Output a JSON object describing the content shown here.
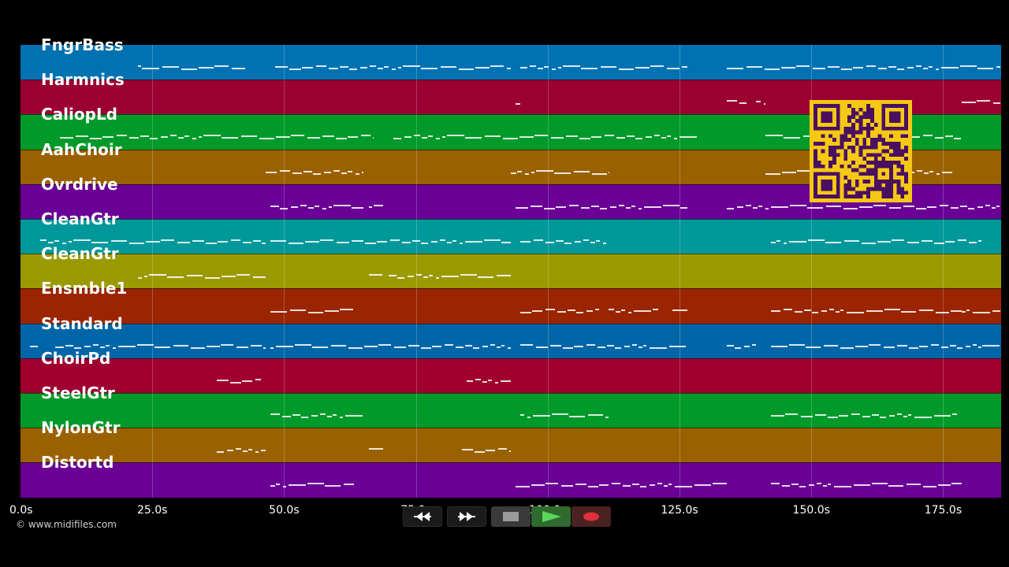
{
  "tracks": [
    {
      "name": "FngrBass",
      "color": "#0072b2",
      "notes": [
        [
          0.12,
          0.23
        ],
        [
          0.26,
          0.5
        ],
        [
          0.51,
          0.68
        ],
        [
          0.72,
          0.999
        ]
      ]
    },
    {
      "name": "Harmnics",
      "color": "#9b0033",
      "notes": [
        [
          0.505,
          0.51
        ],
        [
          0.72,
          0.74
        ],
        [
          0.75,
          0.76
        ],
        [
          0.96,
          0.999
        ]
      ]
    },
    {
      "name": "CaliopLd",
      "color": "#009a2a",
      "notes": [
        [
          0.04,
          0.36
        ],
        [
          0.38,
          0.69
        ],
        [
          0.76,
          0.96
        ]
      ]
    },
    {
      "name": "AahChoir",
      "color": "#9a6100",
      "notes": [
        [
          0.25,
          0.35
        ],
        [
          0.5,
          0.6
        ],
        [
          0.76,
          0.95
        ]
      ]
    },
    {
      "name": "Ovrdrive",
      "color": "#6a0095",
      "notes": [
        [
          0.255,
          0.35
        ],
        [
          0.355,
          0.37
        ],
        [
          0.505,
          0.68
        ],
        [
          0.72,
          0.999
        ]
      ]
    },
    {
      "name": "CleanGtr",
      "color": "#00989a",
      "notes": [
        [
          0.02,
          0.25
        ],
        [
          0.255,
          0.5
        ],
        [
          0.51,
          0.6
        ],
        [
          0.765,
          0.98
        ]
      ]
    },
    {
      "name": "CleanGtr",
      "color": "#9a9a00",
      "notes": [
        [
          0.12,
          0.25
        ],
        [
          0.355,
          0.37
        ],
        [
          0.375,
          0.5
        ]
      ]
    },
    {
      "name": "Ensmble1",
      "color": "#9a2500",
      "notes": [
        [
          0.255,
          0.34
        ],
        [
          0.51,
          0.59
        ],
        [
          0.6,
          0.65
        ],
        [
          0.665,
          0.68
        ],
        [
          0.765,
          0.96
        ],
        [
          0.96,
          0.999
        ]
      ]
    },
    {
      "name": "Standard",
      "color": "#0066a8",
      "notes": [
        [
          0.01,
          0.018
        ],
        [
          0.035,
          0.25
        ],
        [
          0.255,
          0.5
        ],
        [
          0.51,
          0.68
        ],
        [
          0.72,
          0.75
        ],
        [
          0.765,
          0.999
        ]
      ]
    },
    {
      "name": "ChoirPd",
      "color": "#a00030",
      "notes": [
        [
          0.2,
          0.245
        ],
        [
          0.455,
          0.5
        ]
      ]
    },
    {
      "name": "SteelGtr",
      "color": "#009a2a",
      "notes": [
        [
          0.255,
          0.35
        ],
        [
          0.51,
          0.6
        ],
        [
          0.765,
          0.955
        ]
      ]
    },
    {
      "name": "NylonGtr",
      "color": "#9a6100",
      "notes": [
        [
          0.2,
          0.25
        ],
        [
          0.355,
          0.37
        ],
        [
          0.45,
          0.5
        ]
      ]
    },
    {
      "name": "Distortd",
      "color": "#6a0095",
      "notes": [
        [
          0.255,
          0.34
        ],
        [
          0.505,
          0.72
        ],
        [
          0.765,
          0.96
        ]
      ]
    }
  ],
  "axis": {
    "ticks": [
      {
        "label": "0.0s",
        "value": 0
      },
      {
        "label": "25.0s",
        "value": 25
      },
      {
        "label": "50.0s",
        "value": 50
      },
      {
        "label": "75.0s",
        "value": 75
      },
      {
        "label": "100.0s",
        "value": 100
      },
      {
        "label": "125.0s",
        "value": 125
      },
      {
        "label": "150.0s",
        "value": 150
      },
      {
        "label": "175.0s",
        "value": 175
      }
    ],
    "max_seconds": 186
  },
  "copyright": "© www.midifiles.com",
  "transport": {
    "rewind": "rewind-icon",
    "fast_forward": "fast-forward-icon",
    "stop": "stop-icon",
    "play": "play-icon",
    "record": "record-icon"
  },
  "qr": "qr-code-icon"
}
